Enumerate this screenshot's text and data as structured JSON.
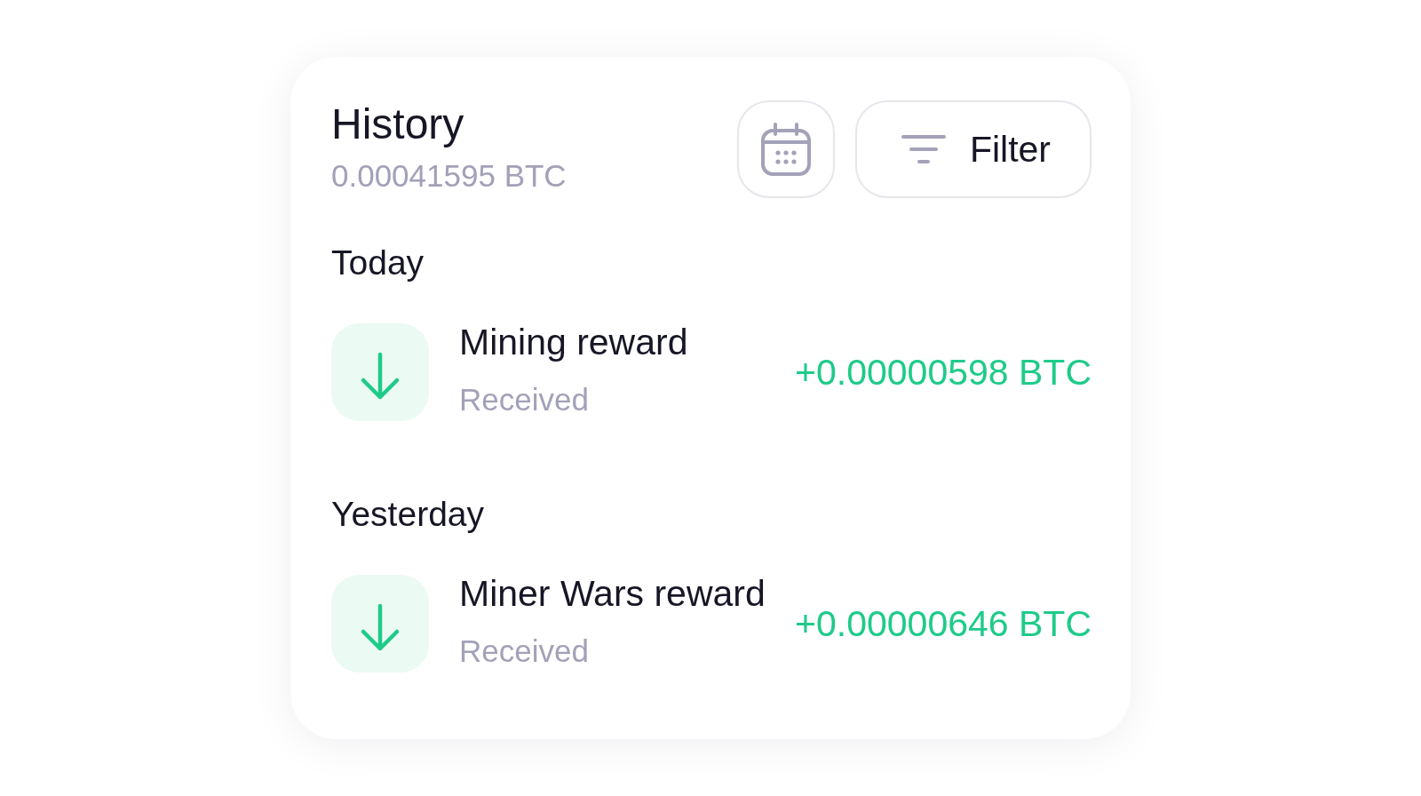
{
  "header": {
    "title": "History",
    "balance": "0.00041595 BTC",
    "filter_button": {
      "label": "Filter"
    }
  },
  "sections": [
    {
      "label": "Today",
      "transactions": [
        {
          "kind": "incoming",
          "title": "Mining reward",
          "status": "Received",
          "amount": "+0.00000598 BTC"
        }
      ]
    },
    {
      "label": "Yesterday",
      "transactions": [
        {
          "kind": "incoming",
          "title": "Miner Wars reward",
          "status": "Received",
          "amount": "+0.00000646 BTC"
        }
      ]
    }
  ]
}
